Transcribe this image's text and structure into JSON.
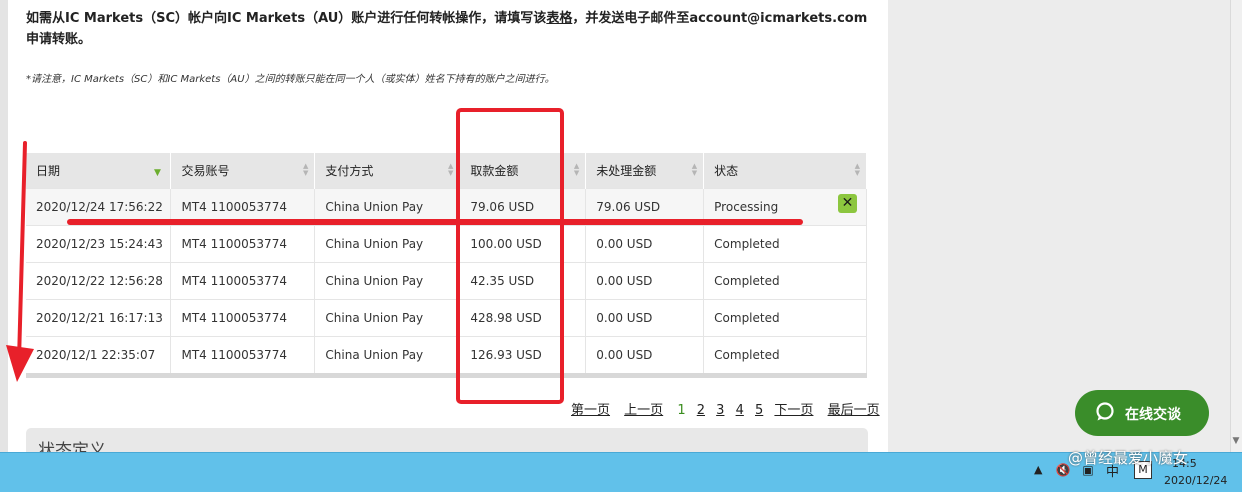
{
  "intro": {
    "before_link": "如需从IC Markets（SC）帐户向IC Markets（AU）账户进行任何转帐操作，请填写该",
    "link": "表格",
    "after_link": "，并发送电子邮件至account@icmarkets.com 申请转账。"
  },
  "note": "*请注意，IC Markets（SC）和IC Markets（AU）之间的转账只能在同一个人（或实体）姓名下持有的账户之间进行。",
  "table": {
    "headers": [
      "日期",
      "交易账号",
      "支付方式",
      "取款金额",
      "未处理金额",
      "状态"
    ],
    "rows": [
      [
        "2020/12/24 17:56:22",
        "MT4 1100053774",
        "China Union Pay",
        "79.06 USD",
        "79.06 USD",
        "Processing"
      ],
      [
        "2020/12/23 15:24:43",
        "MT4 1100053774",
        "China Union Pay",
        "100.00 USD",
        "0.00 USD",
        "Completed"
      ],
      [
        "2020/12/22 12:56:28",
        "MT4 1100053774",
        "China Union Pay",
        "42.35 USD",
        "0.00 USD",
        "Completed"
      ],
      [
        "2020/12/21 16:17:13",
        "MT4 1100053774",
        "China Union Pay",
        "428.98 USD",
        "0.00 USD",
        "Completed"
      ],
      [
        "2020/12/1 22:35:07",
        "MT4 1100053774",
        "China Union Pay",
        "126.93 USD",
        "0.00 USD",
        "Completed"
      ]
    ],
    "cancel_symbol": "✕"
  },
  "pager": {
    "first": "第一页",
    "prev": "上一页",
    "pages": [
      "1",
      "2",
      "3",
      "4",
      "5"
    ],
    "current": "1",
    "next": "下一页",
    "last": "最后一页"
  },
  "status_section": {
    "title": "状态定义"
  },
  "chat": {
    "label": "在线交谈"
  },
  "taskbar": {
    "ime": "中",
    "m_icon": "M",
    "time": "14:5",
    "date": "2020/12/24"
  },
  "watermark": "@曾经最爱小魔女",
  "colors": {
    "accent_green": "#3a8d2a",
    "cancel_green": "#8cc63f",
    "annotation_red": "#e8202a",
    "taskbar": "#61c1ea"
  }
}
